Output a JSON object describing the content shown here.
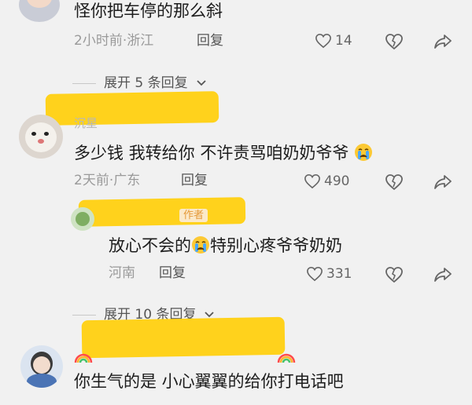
{
  "comments": [
    {
      "text": "怪你把车停的那么斜",
      "time": "2小时前",
      "location": "浙江",
      "reply_label": "回复",
      "likes": "14"
    },
    {
      "username_partial": "沉星",
      "text": "多少钱  我转给你  不许责骂咱奶奶爷爷",
      "time": "2天前",
      "location": "广东",
      "reply_label": "回复",
      "likes": "490"
    },
    {
      "badge": "作者",
      "text_before": "放心不会的",
      "text_after": "特别心疼爷爷奶奶",
      "location": "河南",
      "reply_label": "回复",
      "likes": "331"
    },
    {
      "text": "你生气的是 小心翼翼的给你打电话吧"
    }
  ],
  "expand_1": "展开 5 条回复",
  "expand_2": "展开 10 条回复",
  "separator": "·",
  "icons": [
    "heart-icon",
    "broken-heart-icon",
    "share-icon",
    "chevron-down-icon",
    "crying-emoji-icon",
    "rainbow-icon"
  ],
  "colors": {
    "highlight": "#ffd21c",
    "background": "#f1f1f1"
  }
}
